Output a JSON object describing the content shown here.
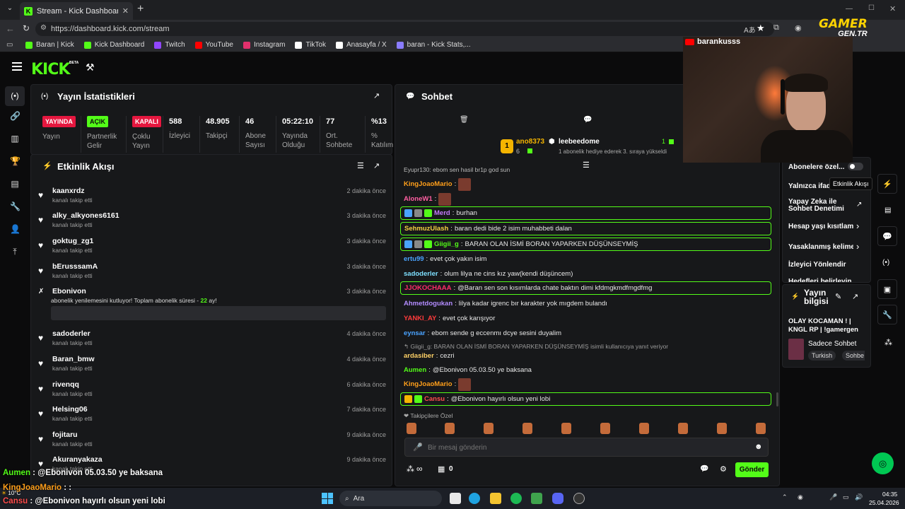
{
  "browser": {
    "tab_title": "Stream - Kick Dashboard",
    "url": "https://dashboard.kick.com/stream",
    "bookmarks": [
      {
        "label": "Baran | Kick",
        "color": "#53fc18"
      },
      {
        "label": "Kick Dashboard",
        "color": "#53fc18"
      },
      {
        "label": "Twitch",
        "color": "#9146ff"
      },
      {
        "label": "YouTube",
        "color": "#ff0000"
      },
      {
        "label": "Instagram",
        "color": "#e1306c"
      },
      {
        "label": "TikTok",
        "color": "#ffffff"
      },
      {
        "label": "Anasayfa / X",
        "color": "#ffffff"
      },
      {
        "label": "baran - Kick Stats,...",
        "color": "#8a7cff"
      }
    ]
  },
  "brand": {
    "logo": "KICK",
    "beta": "BETA"
  },
  "stats": {
    "title": "Yayın İstatistikleri",
    "badges": [
      {
        "value": "YAYINDA",
        "label": "Yayın",
        "color": "#e5173f",
        "text": "#ffffff"
      },
      {
        "value": "AÇIK",
        "label": "Partnerlik Gelir",
        "color": "#53fc18",
        "text": "#0b0b0c"
      },
      {
        "value": "KAPALI",
        "label": "Çoklu Yayın",
        "color": "#e5173f",
        "text": "#ffffff"
      }
    ],
    "values": [
      {
        "value": "588",
        "label": "İzleyici"
      },
      {
        "value": "48.905",
        "label": "Takipçi"
      },
      {
        "value": "46",
        "label": "Abone Sayısı"
      },
      {
        "value": "05:22:10",
        "label": "Yayında Olduğu"
      },
      {
        "value": "77",
        "label": "Ort. Sohbete"
      },
      {
        "value": "%13",
        "label": "% Katılım"
      }
    ]
  },
  "activity": {
    "title": "Etkinlik Akışı",
    "items": [
      {
        "name": "kaanxrdz",
        "sub": "kanalı takip etti",
        "time": "2 dakika önce"
      },
      {
        "name": "alky_alkyones6161",
        "sub": "kanalı takip etti",
        "time": "3 dakika önce"
      },
      {
        "name": "goktug_zg1",
        "sub": "kanalı takip etti",
        "time": "3 dakika önce"
      },
      {
        "name": "bErusssamA",
        "sub": "kanalı takip etti",
        "time": "3 dakika önce"
      }
    ],
    "resub": {
      "name": "Ebonivon",
      "text": "abonelik yenilemesini kutluyor! Toplam abonelik süresi - ",
      "months": "22",
      "suffix": " ay!",
      "time": "3 dakika önce"
    },
    "items2": [
      {
        "name": "sadoderler",
        "sub": "kanalı takip etti",
        "time": "4 dakika önce"
      },
      {
        "name": "Baran_bmw",
        "sub": "kanalı takip etti",
        "time": "4 dakika önce"
      },
      {
        "name": "rivenqq",
        "sub": "kanalı takip etti",
        "time": "6 dakika önce"
      },
      {
        "name": "Helsing06",
        "sub": "kanalı takip etti",
        "time": "7 dakika önce"
      },
      {
        "name": "fojitaru",
        "sub": "kanalı takip etti",
        "time": "9 dakika önce"
      },
      {
        "name": "Akuranyakaza",
        "sub": "kanalı takip etti",
        "time": "9 dakika önce"
      }
    ]
  },
  "chat": {
    "title": "Sohbet",
    "pinned": {
      "user1": "ano8373",
      "count1": "6",
      "user2": "leebeedome",
      "count2": "1",
      "note": "1 abonelik hediye ederek 3. sıraya yükseldi"
    },
    "top_partial": "Eyupr130: ebom sen hasil br1p god sun",
    "messages": [
      {
        "user": "KingJoaoMario",
        "color": "#ff9f1a",
        "text": "",
        "emote": true,
        "hl": false,
        "badges": 0
      },
      {
        "user": "AloneW1",
        "color": "#ff5fa2",
        "text": "",
        "emote": true,
        "hl": false,
        "badges": 0
      },
      {
        "user": "Merd",
        "color": "#c77dff",
        "text": "burhan",
        "emote": false,
        "hl": true,
        "badges": 3
      },
      {
        "user": "SehmuzUlash",
        "color": "#f5d142",
        "text": "baran dedi bide 2 isim muhabbeti dalan",
        "emote": false,
        "hl": true,
        "badges": 0
      },
      {
        "user": "Giigii_g",
        "color": "#53fc18",
        "text": "BARAN OLAN İSMİ BORAN YAPARKEN DÜŞÜNSEYMİŞ",
        "emote": false,
        "hl": true,
        "badges": 3
      },
      {
        "user": "ertu99",
        "color": "#4aa3ff",
        "text": "evet çok yakın isim",
        "emote": false,
        "hl": false,
        "badges": 0
      },
      {
        "user": "sadoderler",
        "color": "#7ee0ff",
        "text": "olum lilya ne cins kız yaw(kendi düşüncem)",
        "emote": false,
        "hl": false,
        "badges": 0
      },
      {
        "user": "JJOKOCHAAA",
        "color": "#ff2d6b",
        "text": "@Baran sen son kısımlarda chate baktın dimi kfdmgkmdfmgdfmg",
        "emote": false,
        "hl": true,
        "badges": 0
      },
      {
        "user": "Ahmetdogukan",
        "color": "#b38cff",
        "text": "lilya kadar igrenc bır karakter yok mıgdem bulandı",
        "emote": false,
        "hl": false,
        "badges": 0
      },
      {
        "user": "YANKI_AY",
        "color": "#ff3b3b",
        "text": "evet çok karışıyor",
        "emote": false,
        "hl": false,
        "badges": 0
      },
      {
        "user": "eynsar",
        "color": "#4aa3ff",
        "text": "ebom sende g eccenmı dcye sesini duyalim",
        "emote": false,
        "hl": false,
        "badges": 0
      }
    ],
    "reply_note": "Giigii_g: BARAN OLAN İSMİ BORAN YAPARKEN DÜŞÜNSEYMİŞ isimli kullanıcıya yanıt veriyor",
    "messages2": [
      {
        "user": "ardasiber",
        "color": "#ffd166",
        "text": "cezri",
        "emote": false,
        "hl": false,
        "badges": 0
      },
      {
        "user": "Aumen",
        "color": "#53fc18",
        "text": "@Ebonivon 05.03.50 ye baksana",
        "emote": false,
        "hl": false,
        "badges": 0
      },
      {
        "user": "KingJoaoMario",
        "color": "#ff9f1a",
        "text": "",
        "emote": true,
        "hl": false,
        "badges": 0
      },
      {
        "user": "Cansu",
        "color": "#ff4d4d",
        "text": "@Ebonivon hayırlı olsun yeni lobi",
        "emote": false,
        "hl": true,
        "badges": 2
      }
    ],
    "follower_only": "Takipçilere Özel",
    "input_placeholder": "Bir mesaj gönderin",
    "points": "∞",
    "gifts": "0",
    "send_label": "Gönder"
  },
  "right_panel": {
    "toggles": [
      {
        "label": "Abonelere özel..."
      },
      {
        "label": "Yalnızca ifade"
      }
    ],
    "tooltip": "Etkinlik Akışı",
    "items": [
      "Yapay Zeka ile Sohbet Denetimi",
      "Hesap yaşı kısıtlama",
      "Yasaklanmış kelimel",
      "İzleyici Yönlendir",
      "Hedefleri belirleyin"
    ],
    "stream_info_title": "Yayın bilgisi",
    "stream_title": "OLAY KOCAMAN ! | KNGL RP | !gamergen",
    "category": "Sadece Sohbet",
    "tags": [
      "Turkish",
      "Sohbe"
    ]
  },
  "webcam": {
    "channel": "barankusss",
    "watermark": "GAMER",
    "watermark_sub": "GEN.TR"
  },
  "overlay_chat": [
    {
      "user": "Aumen",
      "color": "#53fc18",
      "text": "@Ebonivon 05.03.50 ye baksana"
    },
    {
      "user": "KingJoaoMario",
      "color": "#ff9f1a",
      "text": ":"
    },
    {
      "user": "Cansu",
      "color": "#ff4d4d",
      "text": "@Ebonivon hayırlı olsun yeni lobi"
    }
  ],
  "taskbar": {
    "weather_temp": "10°C",
    "search": "Ara",
    "time": "04:35",
    "date": "25.04.2026"
  }
}
